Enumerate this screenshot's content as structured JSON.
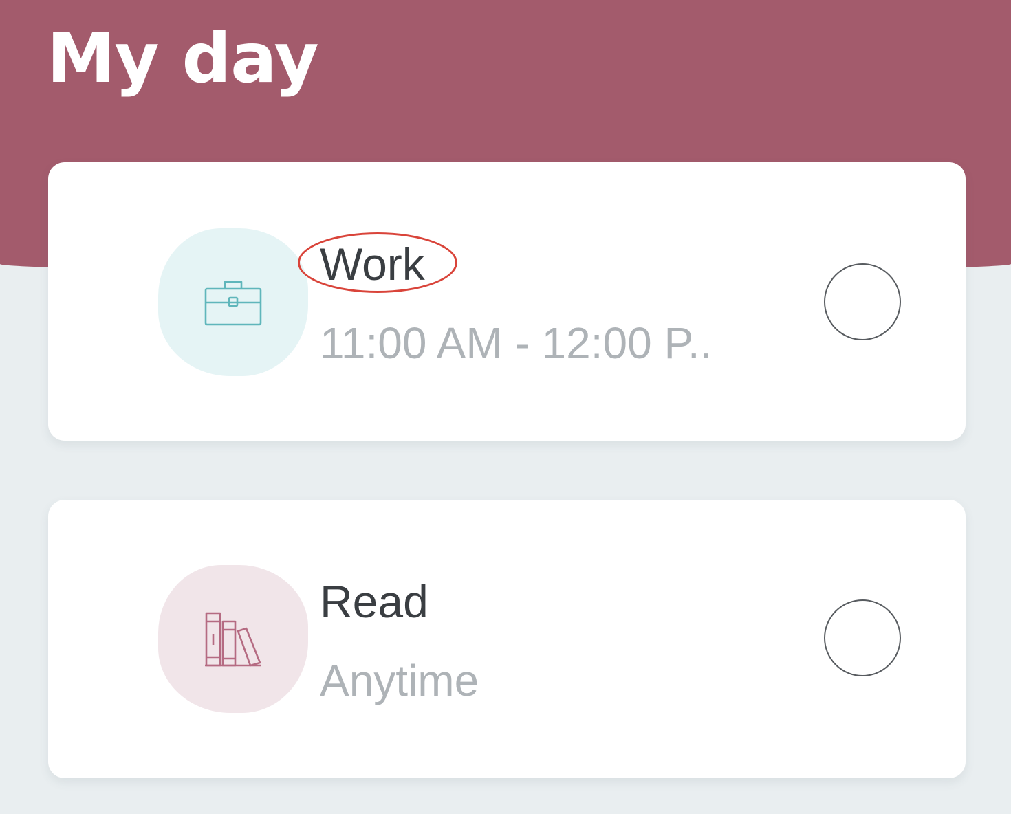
{
  "header": {
    "title": "My day",
    "background_color": "#a35b6c"
  },
  "tasks": [
    {
      "title": "Work",
      "subtitle": "11:00 AM - 12:00 P..",
      "icon": "briefcase-icon",
      "icon_color": "#5fb6bb",
      "icon_bg": "#e5f4f5",
      "completed": false
    },
    {
      "title": "Read",
      "subtitle": "Anytime",
      "icon": "books-icon",
      "icon_color": "#b56b82",
      "icon_bg": "#f1e5e9",
      "completed": false
    }
  ],
  "colors": {
    "page_background": "#e9eef0",
    "highlight": "#d9443a"
  }
}
